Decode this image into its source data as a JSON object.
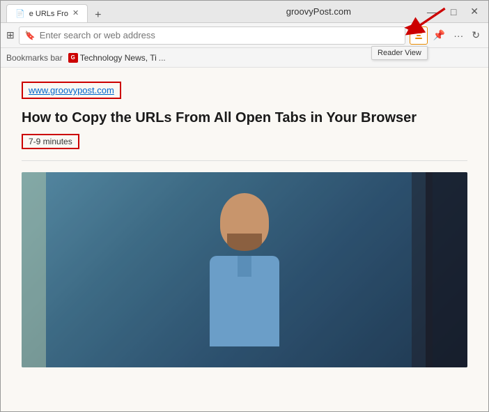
{
  "browser": {
    "title": "groovyPost.com",
    "tab": {
      "title": "e URLs Fro",
      "favicon": "📄"
    },
    "new_tab_label": "+",
    "window_controls": {
      "minimize": "—",
      "maximize": "□",
      "close": "✕"
    }
  },
  "navbar": {
    "address_placeholder": "Enter search or web address",
    "reader_view_tooltip": "Reader View",
    "icons": {
      "grid": "⊞",
      "shield": "🛡",
      "more": "···",
      "refresh": "↻"
    }
  },
  "bookmarks": {
    "label": "Bookmarks bar",
    "items": [
      {
        "name": "Technology News, Ti",
        "favicon": "G"
      }
    ],
    "ellipsis": "..."
  },
  "content": {
    "site_url": "www.groovypost.com",
    "article_title": "How to Copy the URLs From All Open Tabs in Your Browser",
    "read_time": "7-9 minutes"
  }
}
